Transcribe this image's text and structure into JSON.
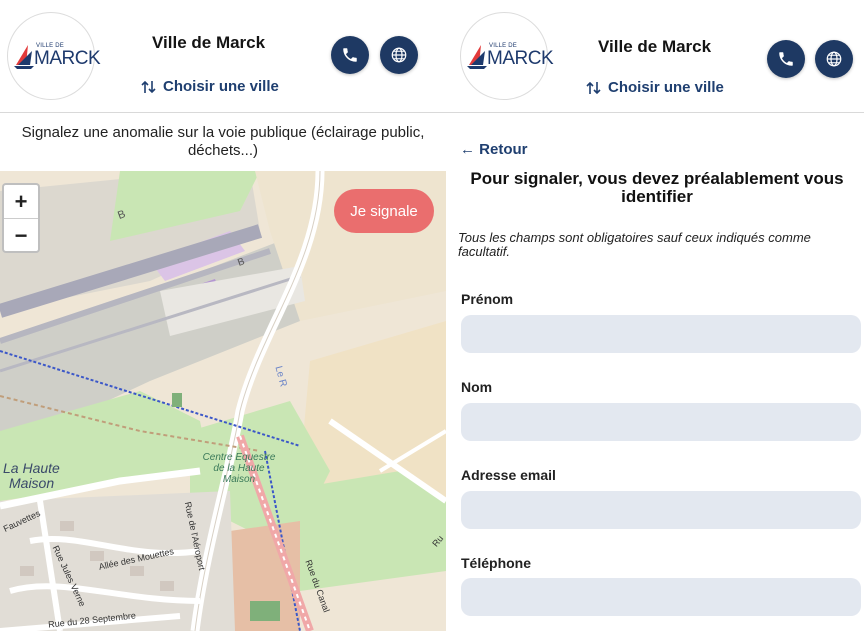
{
  "header": {
    "logo_small": "VILLE DE",
    "logo_text": "MARCK",
    "city_name": "Ville de Marck",
    "choose_city": "Choisir une ville",
    "icons": [
      "phone-icon",
      "globe-icon",
      "sort-arrows-icon"
    ]
  },
  "left": {
    "intro": "Signalez une anomalie sur la voie publique (éclairage public, déchets...)",
    "zoom_in": "+",
    "zoom_out": "−",
    "report_button": "Je signale",
    "map_labels": {
      "b_road": "B",
      "b_road2": "B",
      "le_canal": "Le R",
      "la_haute_1": "La Haute",
      "la_haute_2": "Maison",
      "centre_1": "Centre Equestre",
      "centre_2": "de la Haute",
      "centre_3": "Maison",
      "rue_aeroport": "Rue de l'Aéroport",
      "allee_mouettes": "Allée des Mouettes",
      "rue_jules_verne": "Rue Jules Verne",
      "fauvettes": "Fauvettes",
      "rue_28_sept": "Rue du 28 Septembre",
      "rue_du_canal": "Rue du Canal",
      "rue_r": "Ru"
    }
  },
  "right": {
    "back": "← Retour",
    "title": "Pour signaler, vous devez préalablement vous identifier",
    "note": "Tous les champs sont obligatoires sauf ceux indiqués comme facultatif.",
    "fields": [
      {
        "label": "Prénom",
        "value": ""
      },
      {
        "label": "Nom",
        "value": ""
      },
      {
        "label": "Adresse email",
        "value": ""
      },
      {
        "label": "Téléphone",
        "value": ""
      }
    ]
  },
  "colors": {
    "navy": "#1e3963",
    "link": "#1f3f70",
    "report_button": "#ea6e6e",
    "input_bg": "#e3e8f0"
  }
}
